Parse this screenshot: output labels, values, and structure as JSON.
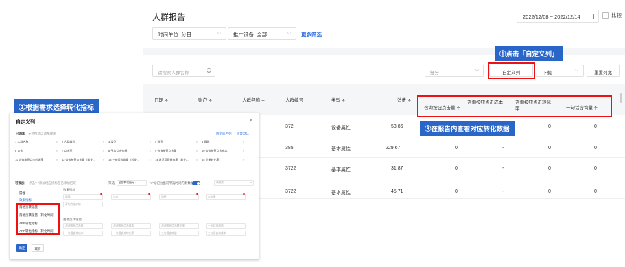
{
  "header": {
    "title": "人群报告",
    "date_range": "2022/12/08 ~ 2022/12/14",
    "compare_label": "比较",
    "time_unit": "时间单位: 分日",
    "device": "推广设备: 全部",
    "more_filters": "更多筛选"
  },
  "toolbar": {
    "search_placeholder": "请搜索人群名称",
    "segment_placeholder": "细分",
    "custom_columns": "自定义列",
    "download": "下载",
    "reset_columns": "重置列宽"
  },
  "callouts": {
    "step1": "①点击「自定义列」",
    "step2": "②根据需求选择转化指标",
    "step3": "③在报告内查看对应转化数据"
  },
  "table": {
    "columns": [
      "日期 ≑",
      "账户 ≑",
      "人群名称 ≑",
      "人群编号",
      "类型 ≑",
      "消费 ≑",
      "咨询按钮点击量 ≑",
      "咨询按钮点击成本",
      "咨询按钮点击转化率",
      "一句话咨询量 ≑"
    ],
    "rows": [
      {
        "id": "372",
        "type": "设备属性",
        "spend": "53.86",
        "c1": "",
        "c2": "",
        "c3": "0",
        "c4": "0"
      },
      {
        "id": "385",
        "type": "基本属性",
        "spend": "229.67",
        "c1": "0",
        "c2": "-",
        "c3": "0",
        "c4": "0"
      },
      {
        "id": "3722",
        "type": "基本属性",
        "spend": "31.87",
        "c1": "0",
        "c2": "-",
        "c3": "0",
        "c4": "0"
      },
      {
        "id": "3722",
        "type": "基本属性",
        "spend": "45.71",
        "c1": "0",
        "c2": "-",
        "c3": "0",
        "c4": "0"
      }
    ]
  },
  "dialog": {
    "title": "自定义列",
    "added_label": "已添加",
    "added_hint": "支持拖动以调整顺序",
    "save_link": "固定前若列",
    "restore_link": "恢复默认",
    "chips": [
      "1 人群名称",
      "2 人群编号",
      "3 类型",
      "4 消费",
      "5 展现",
      "6 点击",
      "7 点击率",
      "8 平均点击价格",
      "9 咨询按钮点击量",
      "10 咨询按钮点击成本",
      "11 咨询按钮点击转化率",
      "12 咨询按钮点击量（转化...",
      "13 一句话咨询量（转化...",
      "14 激活页面留存率（转化...",
      "15 注册转化率"
    ],
    "optional_label": "可添加",
    "optional_hint": "点击\"+\"添加相应指标至已添加区域",
    "filter_label": "筛选",
    "filter_value": "全部转化指标",
    "toggle_hint": "\"●\"标记为当前所选时间内有数据指标",
    "search_placeholder": "请搜索",
    "side_items": [
      "属性",
      "效果指标",
      "落地页转化量",
      "落地页转化量（转化时间）",
      "APP转化指标",
      "APP转化指标（转化时间）"
    ],
    "group_effect": "效果指标",
    "group_landing": "落地页转化量",
    "effect_metrics": [
      "展现",
      "点击",
      "消费",
      "点击率"
    ],
    "effect_row2": [
      "平均点击价格"
    ],
    "landing_metrics": [
      "咨询按钮点击量",
      "咨询按钮点击成本",
      "咨询按钮点击转化率",
      "一句话咨询量"
    ],
    "landing_row2": [
      "一句话咨询成本",
      "一句话咨询转化率",
      "三句话咨询量",
      "三句话咨询成本"
    ],
    "confirm": "确定",
    "cancel": "取消"
  },
  "colors": {
    "accent": "#2a65c8",
    "highlight": "#ee1111",
    "link": "#2f6fe0"
  }
}
